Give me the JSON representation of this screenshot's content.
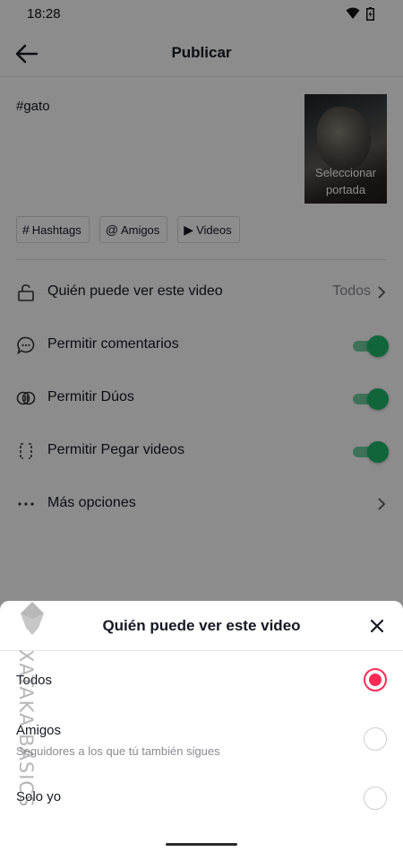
{
  "status_bar": {
    "time": "18:28"
  },
  "header": {
    "title": "Publicar"
  },
  "post": {
    "caption": "#gato",
    "cover_label": "Seleccionar portada",
    "chips": [
      {
        "icon": "#",
        "label": "Hashtags"
      },
      {
        "icon": "@",
        "label": "Amigos"
      },
      {
        "icon": "▶",
        "label": "Videos"
      }
    ]
  },
  "settings": [
    {
      "label": "Quién puede ver este video",
      "value": "Todos"
    },
    {
      "label": "Permitir comentarios",
      "enabled": true
    },
    {
      "label": "Permitir Dúos",
      "enabled": true
    },
    {
      "label": "Permitir Pegar videos",
      "enabled": true
    },
    {
      "label": "Más opciones"
    }
  ],
  "sheet": {
    "title": "Quién puede ver este video",
    "options": [
      {
        "label": "Todos",
        "subtitle": "",
        "selected": true
      },
      {
        "label": "Amigos",
        "subtitle": "Seguidores a los que tú también sigues",
        "selected": false
      },
      {
        "label": "Solo yo",
        "subtitle": "",
        "selected": false
      }
    ]
  },
  "watermark": {
    "text": "XATAKA BASICS"
  },
  "colors": {
    "accent": "#fe2c55",
    "toggle_on": "#20b86c",
    "text_primary": "#161823",
    "text_secondary": "#8a8b91"
  }
}
